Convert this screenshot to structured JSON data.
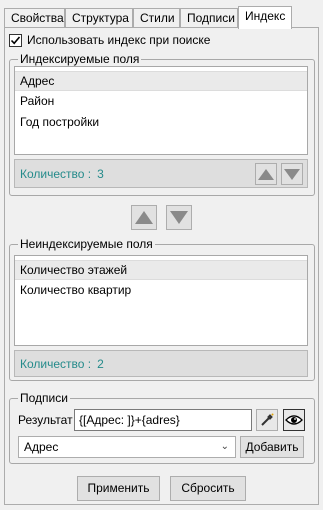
{
  "tabs": [
    {
      "label": "Свойства"
    },
    {
      "label": "Структура"
    },
    {
      "label": "Стили"
    },
    {
      "label": "Подписи"
    },
    {
      "label": "Индекс"
    }
  ],
  "use_index": {
    "label": "Использовать индекс при поиске",
    "checked": true
  },
  "indexed": {
    "title": "Индексируемые поля",
    "items": [
      "Адрес",
      "Район",
      "Год постройки"
    ],
    "count_label": "Количество :",
    "count": "3"
  },
  "non_indexed": {
    "title": "Неиндексируемые поля",
    "items": [
      "Количество этажей",
      "Количество квартир"
    ],
    "count_label": "Количество :",
    "count": "2"
  },
  "captions": {
    "title": "Подписи",
    "result_label": "Результат",
    "result_value": "{[Адрес: ]}+{adres}",
    "field_select": "Адрес",
    "add_button": "Добавить"
  },
  "footer": {
    "apply": "Применить",
    "reset": "Сбросить"
  },
  "colors": {
    "count_text": "#258b8b",
    "arrow": "#8a8a8a"
  }
}
